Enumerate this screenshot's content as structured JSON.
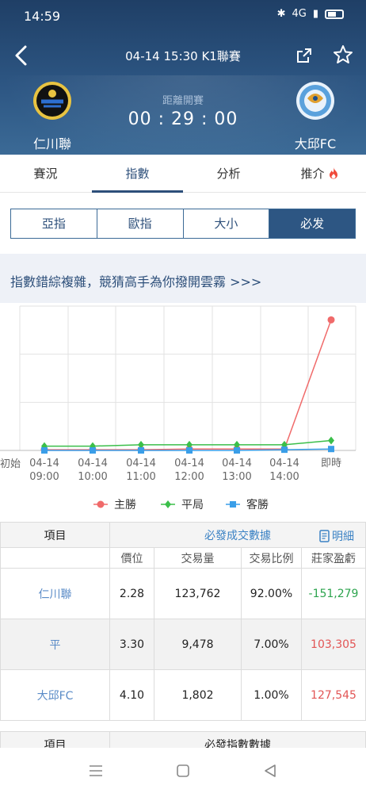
{
  "status": {
    "time": "14:59",
    "network": "4G"
  },
  "nav": {
    "title": "04-14 15:30 K1聯賽"
  },
  "home": {
    "name": "仁川聯"
  },
  "away": {
    "name": "大邱FC"
  },
  "countdown": {
    "label": "距離開賽",
    "value": "00 : 29 : 00"
  },
  "tabs": [
    "賽況",
    "指數",
    "分析",
    "推介"
  ],
  "segments": [
    "亞指",
    "歐指",
    "大小",
    "必发"
  ],
  "promo": {
    "text": "指數錯綜複雜，競猜高手為你撥開雲霧 >>>"
  },
  "chart_data": {
    "type": "line",
    "x": [
      "初始",
      "04-14 09:00",
      "04-14 10:00",
      "04-14 11:00",
      "04-14 12:00",
      "04-14 13:00",
      "04-14 14:00",
      "即時"
    ],
    "x_tick_labels": [
      [
        "初始"
      ],
      [
        "04-14",
        "09:00"
      ],
      [
        "04-14",
        "10:00"
      ],
      [
        "04-14",
        "11:00"
      ],
      [
        "04-14",
        "12:00"
      ],
      [
        "04-14",
        "13:00"
      ],
      [
        "04-14",
        "14:00"
      ],
      [
        "即時"
      ]
    ],
    "series": [
      {
        "name": "主勝",
        "color": "#f06a6a",
        "values": [
          0.5,
          0.5,
          0.5,
          0.5,
          1,
          1,
          1,
          92
        ]
      },
      {
        "name": "平局",
        "color": "#3bbf4a",
        "values": [
          3,
          3,
          3,
          4,
          4,
          4,
          4,
          7
        ]
      },
      {
        "name": "客勝",
        "color": "#3a9ee8",
        "values": [
          0,
          0,
          0,
          0,
          0,
          0,
          0.5,
          1
        ]
      }
    ],
    "grid": true
  },
  "table": {
    "header_left": "項目",
    "header_right": "必發成交數據",
    "details": "明細",
    "columns": [
      "價位",
      "交易量",
      "交易比例",
      "莊家盈虧"
    ],
    "rows": [
      {
        "name": "仁川聯",
        "price": "2.28",
        "volume": "123,762",
        "ratio": "92.00%",
        "pl": "-151,279"
      },
      {
        "name": "平",
        "price": "3.30",
        "volume": "9,478",
        "ratio": "7.00%",
        "pl": "103,305"
      },
      {
        "name": "大邱FC",
        "price": "4.10",
        "volume": "1,802",
        "ratio": "1.00%",
        "pl": "127,545"
      }
    ]
  },
  "table2": {
    "header_left": "項目",
    "header_right": "必發指數數據"
  }
}
